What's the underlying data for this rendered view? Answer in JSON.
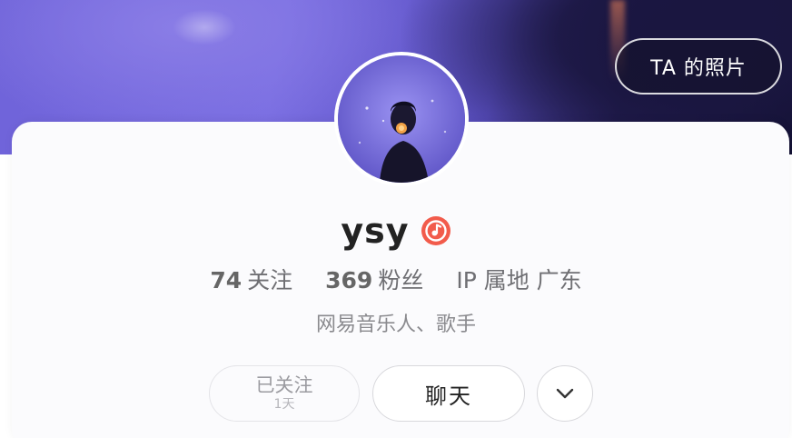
{
  "header": {
    "photos_button_label": "TA 的照片"
  },
  "profile": {
    "name": "ysy",
    "badge_icon": "music-note-icon",
    "badge_color": "#f25b4b",
    "stats": {
      "following_count": "74",
      "following_label": "关注",
      "followers_count": "369",
      "followers_label": "粉丝",
      "ip_label": "IP 属地 广东"
    },
    "bio": "网易音乐人、歌手"
  },
  "actions": {
    "followed_label": "已关注",
    "followed_duration": "1天",
    "chat_label": "聊天",
    "more_icon": "chevron-down-icon"
  }
}
